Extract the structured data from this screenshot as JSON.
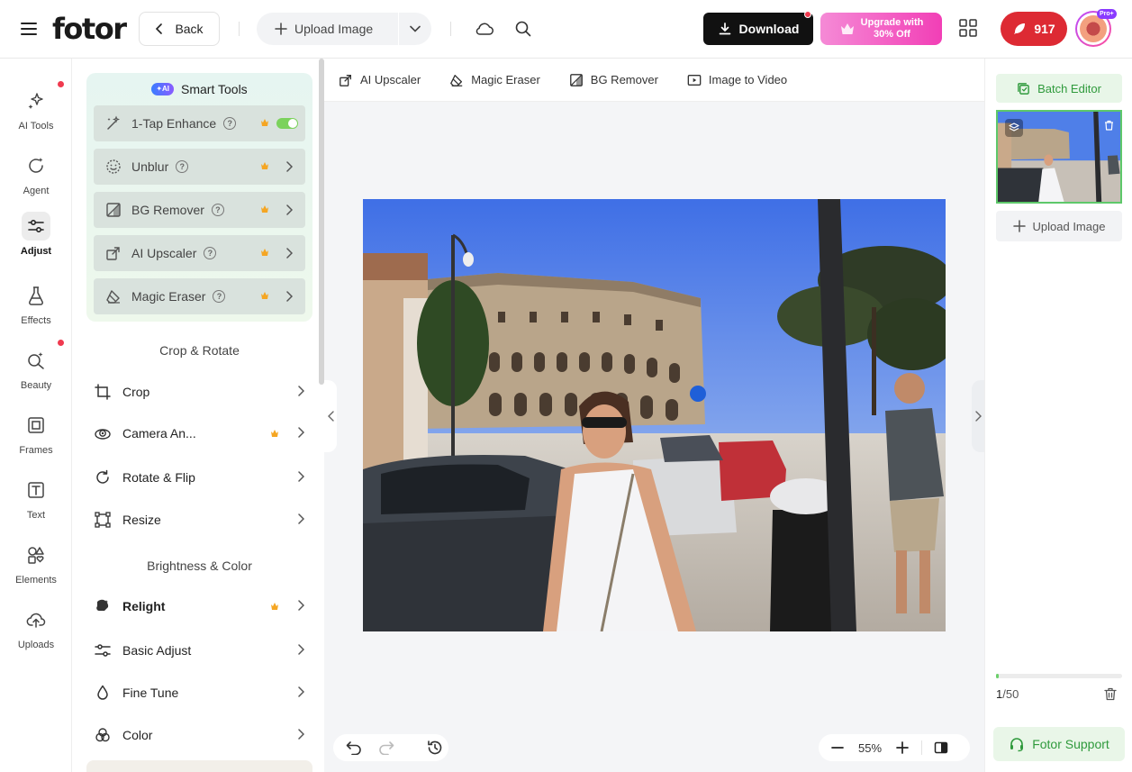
{
  "header": {
    "logo": "fotor",
    "back_label": "Back",
    "upload_label": "Upload Image",
    "download_label": "Download",
    "upgrade_line1": "Upgrade with",
    "upgrade_line2": "30% Off",
    "credits": "917",
    "pro_badge": "Pro+"
  },
  "rail": {
    "items": [
      {
        "label": "AI Tools"
      },
      {
        "label": "Agent"
      },
      {
        "label": "Adjust"
      },
      {
        "label": "Effects"
      },
      {
        "label": "Beauty"
      },
      {
        "label": "Frames"
      },
      {
        "label": "Text"
      },
      {
        "label": "Elements"
      },
      {
        "label": "Uploads"
      }
    ],
    "active": "Adjust"
  },
  "panel": {
    "smart_tools": {
      "badge": "AI",
      "title": "Smart Tools",
      "items": [
        {
          "label": "1-Tap Enhance",
          "icon": "magic-wand-icon",
          "toggle": true
        },
        {
          "label": "Unblur",
          "icon": "face-icon"
        },
        {
          "label": "BG Remover",
          "icon": "bg-remove-icon"
        },
        {
          "label": "AI Upscaler",
          "icon": "upscale-icon"
        },
        {
          "label": "Magic Eraser",
          "icon": "eraser-icon"
        }
      ],
      "help_glyph": "?"
    },
    "crop_section": {
      "title": "Crop & Rotate",
      "items": [
        {
          "label": "Crop"
        },
        {
          "label": "Camera An..."
        },
        {
          "label": "Rotate & Flip"
        },
        {
          "label": "Resize"
        }
      ]
    },
    "color_section": {
      "title": "Brightness & Color",
      "items": [
        {
          "label": "Relight"
        },
        {
          "label": "Basic Adjust"
        },
        {
          "label": "Fine Tune"
        },
        {
          "label": "Color"
        }
      ]
    }
  },
  "toolbar": {
    "items": [
      {
        "label": "AI Upscaler"
      },
      {
        "label": "Magic Eraser"
      },
      {
        "label": "BG Remover"
      },
      {
        "label": "Image to Video"
      }
    ]
  },
  "canvas": {
    "zoom": "55%"
  },
  "right": {
    "batch_label": "Batch Editor",
    "upload_label": "Upload Image",
    "count_current": "1",
    "count_total": "/50",
    "progress": 0.02,
    "support_label": "Fotor Support"
  },
  "colors": {
    "accent_green": "#2f9a3c",
    "download_bg": "#111111",
    "credits_bg": "#dd2a33",
    "upgrade_gradient": [
      "#f58ad6",
      "#f23fb6"
    ],
    "crown": "#f5a623"
  }
}
